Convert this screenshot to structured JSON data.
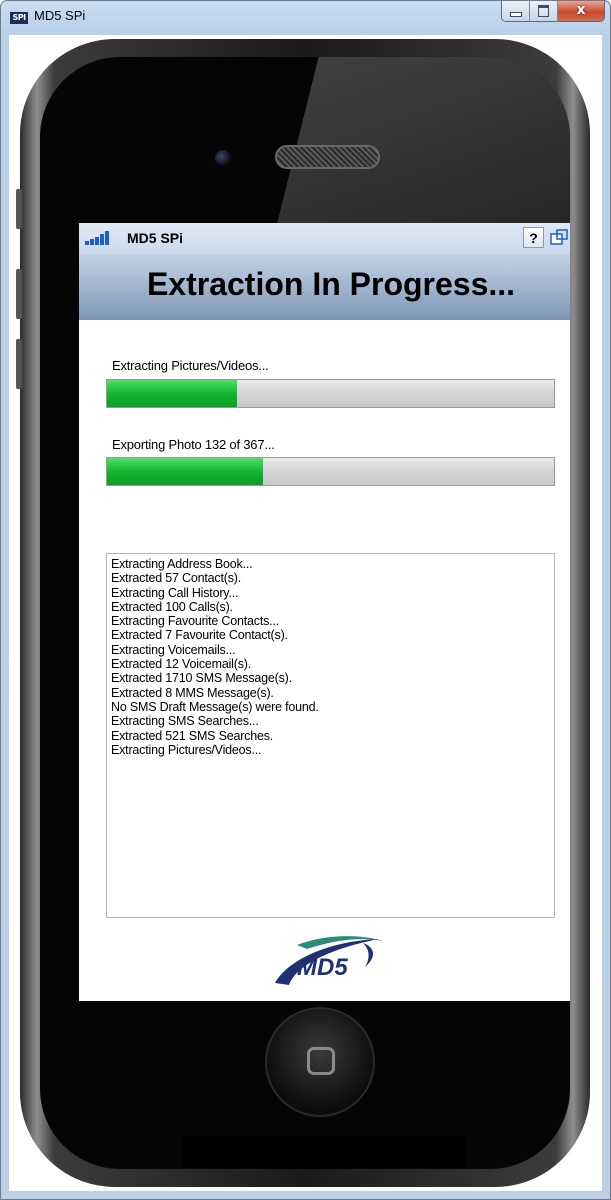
{
  "window": {
    "title": "MD5 SPi",
    "icon_label": "SPI",
    "buttons": {
      "minimize": "minimize",
      "maximize": "maximize",
      "close": "x"
    }
  },
  "app": {
    "title": "MD5 SPi",
    "help_label": "?",
    "header_title": "Extraction In Progress...",
    "progress1": {
      "label": "Extracting Pictures/Videos...",
      "percent": 29
    },
    "progress2": {
      "label": "Exporting Photo 132 of 367...",
      "percent": 35
    },
    "log": [
      "Extracting Address Book...",
      "Extracted 57  Contact(s).",
      "Extracting Call History...",
      "Extracted 100  Calls(s).",
      "Extracting Favourite Contacts...",
      "Extracted 7  Favourite Contact(s).",
      "Extracting Voicemails...",
      "Extracted 12  Voicemail(s).",
      "Extracted 1710  SMS Message(s).",
      "Extracted 8  MMS Message(s).",
      "No  SMS Draft Message(s) were found.",
      "Extracting SMS Searches...",
      "Extracted 521  SMS Searches.",
      "Extracting Pictures/Videos..."
    ],
    "logo_text": "MD5"
  },
  "colors": {
    "progress_green": "#13b52f",
    "signal_blue": "#1b5fcf",
    "logo_navy": "#1f3172",
    "logo_teal": "#2e8a7a"
  }
}
